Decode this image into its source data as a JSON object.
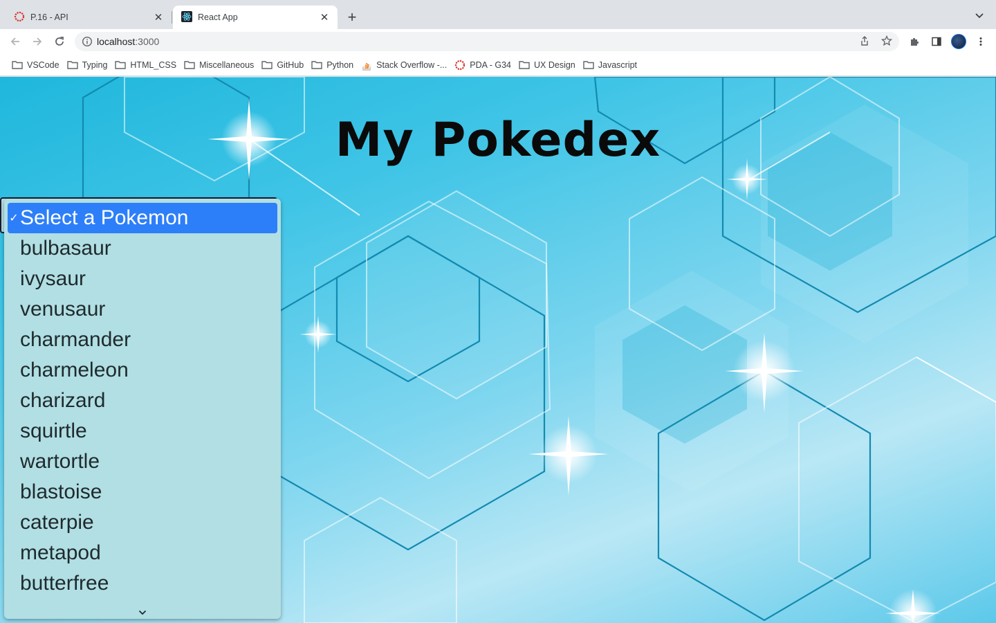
{
  "browser": {
    "tabs": [
      {
        "title": "P.16 - API",
        "active": false,
        "icon": "red-dotted-ring-icon"
      },
      {
        "title": "React App",
        "active": true,
        "icon": "react-logo-icon"
      }
    ],
    "address": {
      "host": "localhost",
      "port": ":3000"
    },
    "bookmarks": [
      {
        "label": "VSCode",
        "icon": "folder-icon"
      },
      {
        "label": "Typing",
        "icon": "folder-icon"
      },
      {
        "label": "HTML_CSS",
        "icon": "folder-icon"
      },
      {
        "label": "Miscellaneous",
        "icon": "folder-icon"
      },
      {
        "label": "GitHub",
        "icon": "folder-icon"
      },
      {
        "label": "Python",
        "icon": "folder-icon"
      },
      {
        "label": "Stack Overflow -...",
        "icon": "stackoverflow-icon"
      },
      {
        "label": "PDA - G34",
        "icon": "red-dotted-ring-icon"
      },
      {
        "label": "UX Design",
        "icon": "folder-icon"
      },
      {
        "label": "Javascript",
        "icon": "folder-icon"
      }
    ]
  },
  "page": {
    "heading": "My Pokedex",
    "select": {
      "selected": "Select a Pokemon",
      "options": [
        "bulbasaur",
        "ivysaur",
        "venusaur",
        "charmander",
        "charmeleon",
        "charizard",
        "squirtle",
        "wartortle",
        "blastoise",
        "caterpie",
        "metapod",
        "butterfree"
      ]
    },
    "colors": {
      "selected_option": "#2d7ff9",
      "dropdown_bg": "#b1dfe3",
      "hexagon_stroke": "#138ab0"
    }
  }
}
